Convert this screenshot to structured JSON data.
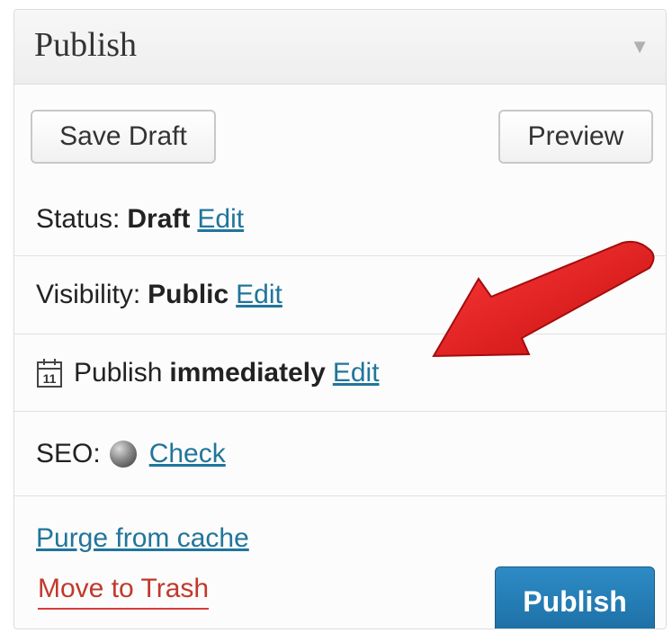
{
  "header": {
    "title": "Publish",
    "toggle_icon": "triangle-down-icon"
  },
  "actions": {
    "save_draft_label": "Save Draft",
    "preview_label": "Preview"
  },
  "status": {
    "label": "Status:",
    "value": "Draft",
    "edit_label": "Edit"
  },
  "visibility": {
    "label": "Visibility:",
    "value": "Public",
    "edit_label": "Edit"
  },
  "schedule": {
    "icon": "calendar-icon",
    "calendar_day": "11",
    "label": "Publish",
    "value": "immediately",
    "edit_label": "Edit"
  },
  "seo": {
    "label": "SEO:",
    "indicator_icon": "status-orb-icon",
    "check_label": "Check"
  },
  "footer": {
    "purge_label": "Purge from cache",
    "trash_label": "Move to Trash",
    "publish_label": "Publish"
  },
  "colors": {
    "link": "#21759b",
    "trash": "#c0392b",
    "publish_button": "#2278b3",
    "annotation_arrow": "#e01818"
  }
}
